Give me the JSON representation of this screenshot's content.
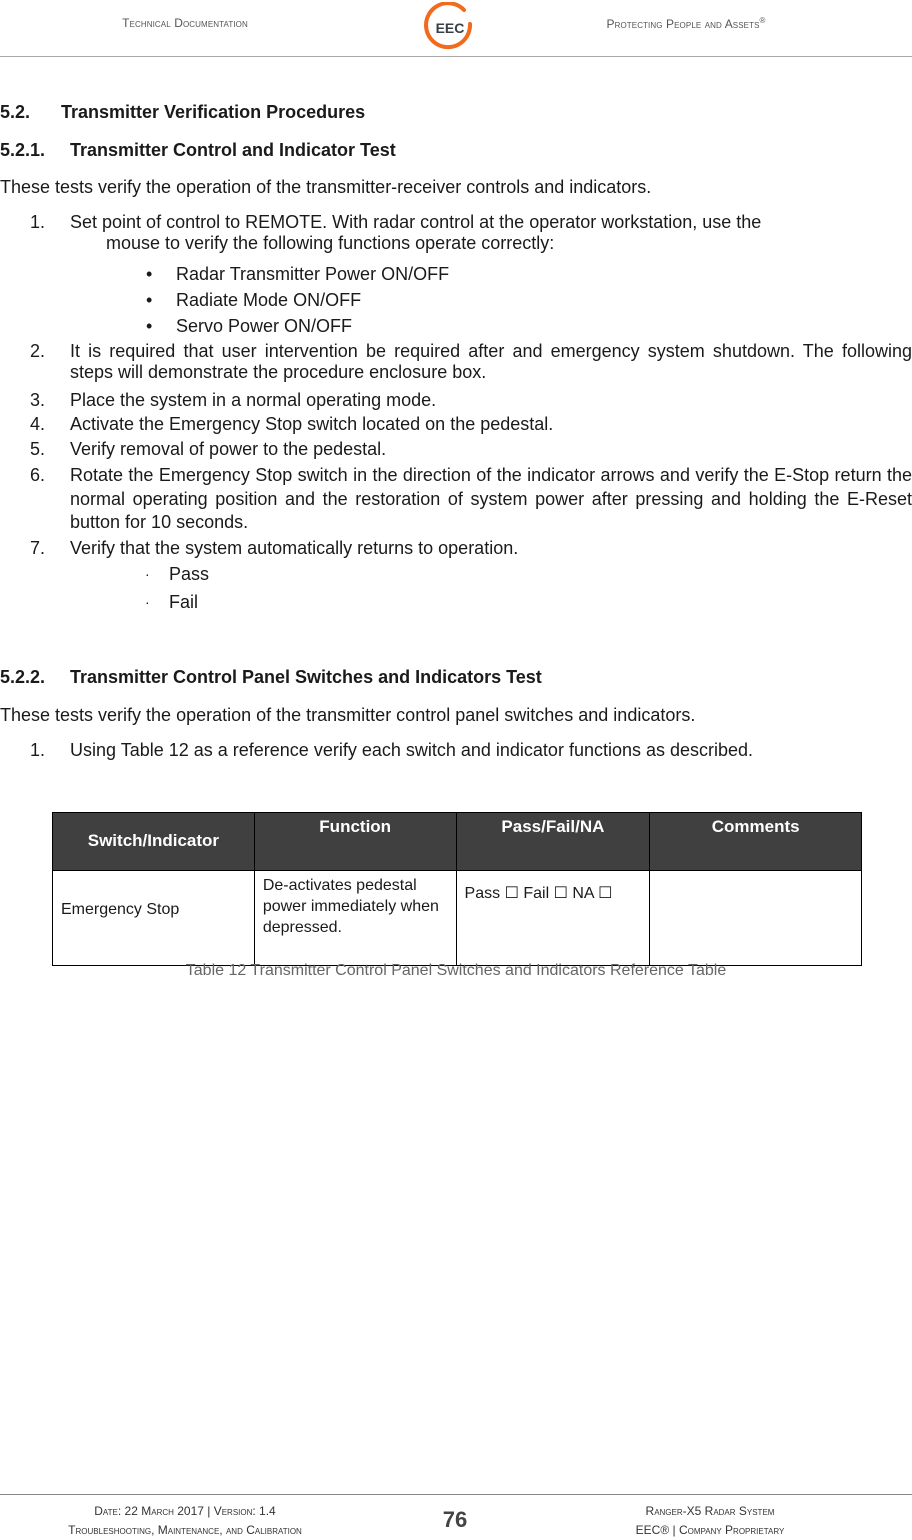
{
  "header": {
    "left": "Technical Documentation",
    "right": "Protecting People and Assets",
    "right_mark": "®",
    "logo_text": "EEC",
    "logo_color": "#f26a1b"
  },
  "section": {
    "number": "5.2.",
    "title": "Transmitter Verification Procedures"
  },
  "sub1": {
    "number": "5.2.1.",
    "title": "Transmitter Control and Indicator Test",
    "intro": "These tests verify the operation of the transmitter-receiver controls and indicators.",
    "steps": [
      {
        "n": "1.",
        "line1": "Set point of control to REMOTE.  With radar control at the operator workstation, use the",
        "line2": "mouse to verify the following functions operate correctly:"
      },
      {
        "n": "2.",
        "text": "It is required that user intervention be required after and emergency system shutdown. The following steps will demonstrate the procedure enclosure box."
      },
      {
        "n": "3.",
        "text": "Place the system in a normal operating mode."
      },
      {
        "n": "4.",
        "text": "Activate the Emergency Stop switch located on the pedestal."
      },
      {
        "n": "5.",
        "text": "Verify removal of power to the pedestal."
      },
      {
        "n": "6.",
        "text": "Rotate the Emergency Stop switch in the direction of the indicator arrows and verify the E-Stop return the normal operating position and the restoration of system power after pressing and holding the E-Reset button for 10 seconds."
      },
      {
        "n": "7.",
        "text": "Verify that the system automatically returns to operation."
      }
    ],
    "functions": [
      "Radar Transmitter Power ON/OFF",
      "Radiate Mode ON/OFF",
      "Servo Power ON/OFF"
    ],
    "results": [
      "Pass",
      "Fail"
    ]
  },
  "sub2": {
    "number": "5.2.2.",
    "title": "Transmitter Control Panel Switches and Indicators Test",
    "intro": "These tests verify the operation of the transmitter control panel switches and indicators.",
    "steps": [
      {
        "n": "1.",
        "text": "Using Table 12 as a reference verify each switch and indicator functions as described."
      }
    ]
  },
  "table": {
    "headers": [
      "Switch/Indicator",
      "Function",
      "Pass/Fail/NA",
      "Comments"
    ],
    "rows": [
      {
        "switch": "Emergency Stop",
        "function": "De-activates pedestal power immediately when depressed.",
        "result": "Pass ☐ Fail ☐ NA ☐",
        "comments": ""
      }
    ],
    "caption": "Table 12 Transmitter Control Panel Switches and Indicators Reference Table"
  },
  "footer": {
    "left_line1": "Date: 22 March 2017 | Version: 1.4",
    "left_line2": "Troubleshooting, Maintenance, and Calibration",
    "page": "76",
    "right_line1": "Ranger-X5 Radar System",
    "right_line2": "EEC® | Company Proprietary"
  }
}
